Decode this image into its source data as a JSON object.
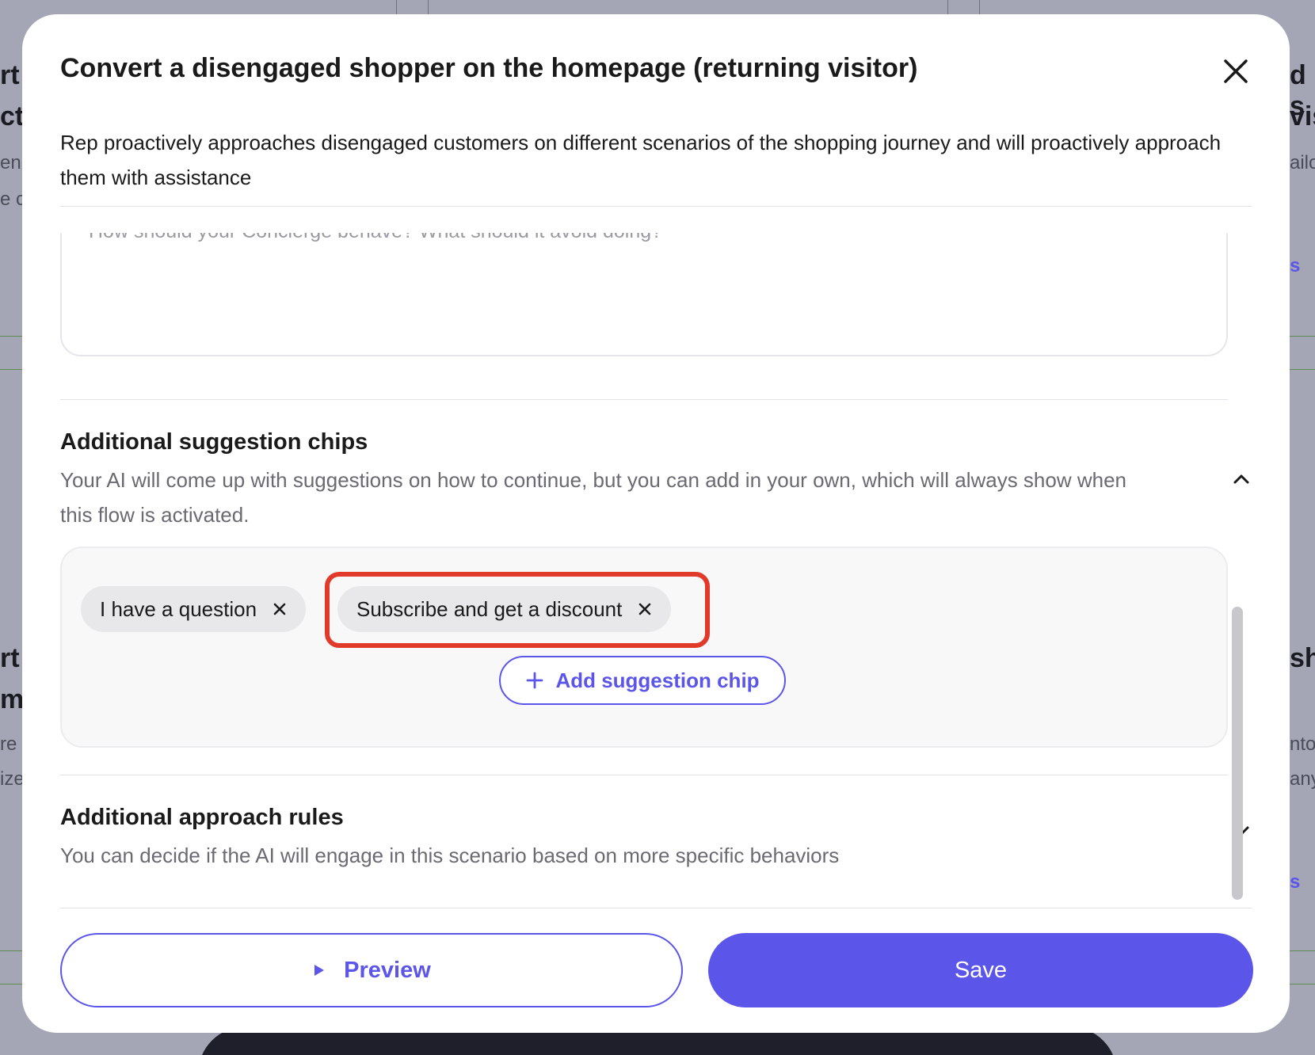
{
  "background": {
    "fragments": [
      "rt",
      "ct",
      "en",
      "e c",
      "rt",
      "m",
      "re",
      "ize",
      "d s",
      "vis",
      "ailo",
      "s",
      "sh",
      "nto",
      "any",
      "s"
    ]
  },
  "modal": {
    "title": "Convert a disengaged shopper on the homepage (returning visitor)",
    "description": "Rep proactively approaches disengaged customers on different scenarios of the shopping journey and will proactively approach them with assistance",
    "behavior_placeholder": "How should your Concierge behave? What should it avoid doing?",
    "suggestion_section": {
      "title": "Additional suggestion chips",
      "description": "Your AI will come up with suggestions on how to continue, but you can add in your own, which will always show when this flow is activated.",
      "chips": [
        {
          "label": "I have a question"
        },
        {
          "label": "Subscribe and get a discount"
        }
      ],
      "add_label": "Add suggestion chip"
    },
    "approach_section": {
      "title": "Additional approach rules",
      "description": "You can decide if the AI will engage in this scenario based on more specific behaviors"
    },
    "preview_label": "Preview",
    "save_label": "Save"
  },
  "colors": {
    "accent": "#5b55ea",
    "highlight": "#e23a2a",
    "overlay": "#a4a6b6"
  }
}
